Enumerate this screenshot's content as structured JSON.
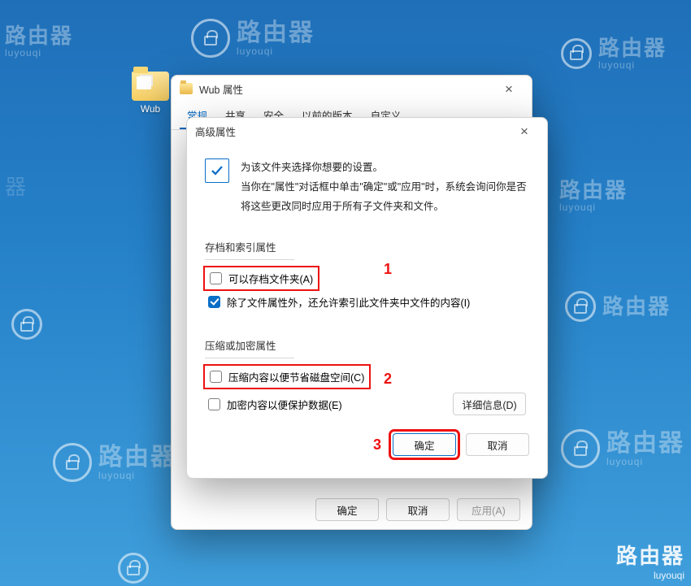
{
  "watermark": {
    "cn": "路由器",
    "py": "luyouqi"
  },
  "desktop": {
    "icon_label": "Wub"
  },
  "parent_dialog": {
    "title": "Wub 属性",
    "tabs": [
      "常规",
      "共享",
      "安全",
      "以前的版本",
      "自定义"
    ],
    "active_tab": 0,
    "buttons": {
      "ok": "确定",
      "cancel": "取消",
      "apply": "应用(A)"
    }
  },
  "adv_dialog": {
    "title": "高级属性",
    "intro_line1": "为该文件夹选择你想要的设置。",
    "intro_line2": "当你在\"属性\"对话框中单击\"确定\"或\"应用\"时，系统会询问你是否将这些更改同时应用于所有子文件夹和文件。",
    "group_archive": "存档和索引属性",
    "cb_archive": "可以存档文件夹(A)",
    "cb_index": "除了文件属性外，还允许索引此文件夹中文件的内容(I)",
    "group_compress": "压缩或加密属性",
    "cb_compress": "压缩内容以便节省磁盘空间(C)",
    "cb_encrypt": "加密内容以便保护数据(E)",
    "details_button": "详细信息(D)",
    "ok": "确定",
    "cancel": "取消"
  },
  "annotations": {
    "a1": "1",
    "a2": "2",
    "a3": "3"
  }
}
